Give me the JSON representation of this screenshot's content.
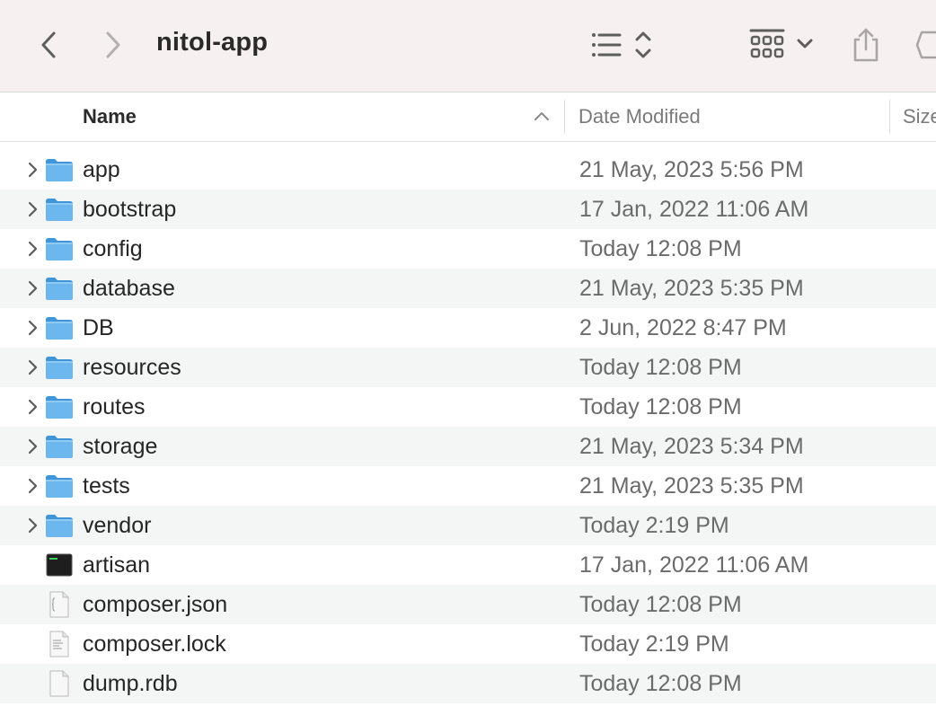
{
  "window": {
    "title": "nitol-app"
  },
  "toolbar": {
    "back_icon": "chevron-left-icon",
    "forward_icon": "chevron-right-icon",
    "view_icon": "list-view-icon",
    "group_icon": "grid-group-icon",
    "share_icon": "share-icon",
    "tag_icon": "tag-icon"
  },
  "columns": {
    "name": "Name",
    "date": "Date Modified",
    "size": "Size"
  },
  "files": [
    {
      "name": "app",
      "date": "21 May, 2023 5:56 PM",
      "type": "folder"
    },
    {
      "name": "bootstrap",
      "date": "17 Jan, 2022 11:06 AM",
      "type": "folder"
    },
    {
      "name": "config",
      "date": "Today 12:08 PM",
      "type": "folder"
    },
    {
      "name": "database",
      "date": "21 May, 2023 5:35 PM",
      "type": "folder"
    },
    {
      "name": "DB",
      "date": "2 Jun, 2022 8:47 PM",
      "type": "folder"
    },
    {
      "name": "resources",
      "date": "Today 12:08 PM",
      "type": "folder"
    },
    {
      "name": "routes",
      "date": "Today 12:08 PM",
      "type": "folder"
    },
    {
      "name": "storage",
      "date": "21 May, 2023 5:34 PM",
      "type": "folder"
    },
    {
      "name": "tests",
      "date": "21 May, 2023 5:35 PM",
      "type": "folder"
    },
    {
      "name": "vendor",
      "date": "Today 2:19 PM",
      "type": "folder"
    },
    {
      "name": "artisan",
      "date": "17 Jan, 2022 11:06 AM",
      "type": "executable"
    },
    {
      "name": "composer.json",
      "date": "Today 12:08 PM",
      "type": "json"
    },
    {
      "name": "composer.lock",
      "date": "Today 2:19 PM",
      "type": "text"
    },
    {
      "name": "dump.rdb",
      "date": "Today 12:08 PM",
      "type": "document"
    }
  ]
}
